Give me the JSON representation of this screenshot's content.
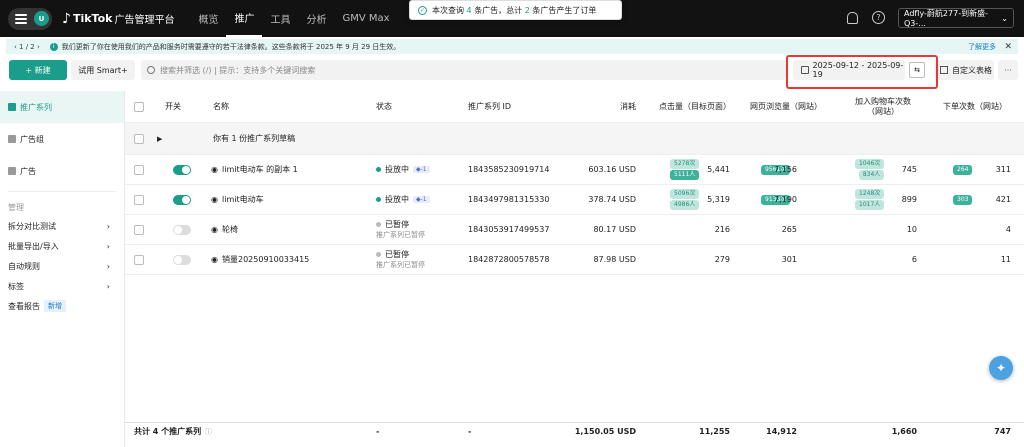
{
  "topbar": {
    "avatar_letter": "U",
    "logo_text": "TikTok",
    "logo_sub": "广告管理平台",
    "nav": [
      "概览",
      "推广",
      "工具",
      "分析",
      "GMV Max"
    ],
    "account": "Adfly-蔚航277-到新盛-Q3-..."
  },
  "toast": {
    "prefix": "本次查询",
    "ads_count": "4",
    "mid": "条广告，总计",
    "orders_count": "2",
    "suffix": "条广告产生了订单"
  },
  "notice": {
    "pager": "‹ 1 / 2 ›",
    "text": "我们更新了你在使用我们的产品和服务时需要遵守的若干法律条款。这些条款将于 2025 年 9 月 29 日生效。",
    "more": "了解更多"
  },
  "toolbar": {
    "new_label": "+ 新建",
    "smart_label": "试用 Smart+",
    "search_placeholder": "搜索并筛选 (/) | 提示：支持多个关键词搜索",
    "date_range": "2025-09-12 - 2025-09-19",
    "custom_label": "自定义表格",
    "more": "···"
  },
  "sidebar": {
    "items": [
      "推广系列",
      "广告组",
      "广告"
    ],
    "manage_heading": "管理",
    "manage": [
      "拆分对比测试",
      "批量导出/导入",
      "自动规则",
      "标签",
      "查看报告"
    ],
    "new_badge": "新增"
  },
  "table": {
    "headers": {
      "switch": "开关",
      "name": "名称",
      "status": "状态",
      "id": "推广系列 ID",
      "spend": "消耗",
      "clicks": "点击量（目标页面）",
      "views": "网页浏览量（网站）",
      "cart": "加入购物车次数",
      "cart2": "（网站）",
      "orders": "下单次数（网站）"
    },
    "draft": "你有 1 份推广系列草稿",
    "rows": [
      {
        "name": "limit电动车 的副本 1",
        "status": "投放中",
        "pill": "1",
        "sub": "",
        "id": "1843585230919714",
        "spend": "603.16 USD",
        "clicks_tag1": "5278次",
        "clicks_tag2": "5111人",
        "clicks": "5,441",
        "views_tag": "9561次",
        "views": "7,156",
        "cart_tag1": "1046次",
        "cart_tag2": "834人",
        "cart": "745",
        "orders_tag": "264",
        "orders": "311"
      },
      {
        "name": "limit电动车",
        "status": "投放中",
        "pill": "1",
        "sub": "",
        "id": "1843497981315330",
        "spend": "378.74 USD",
        "clicks_tag1": "5096次",
        "clicks_tag2": "4986人",
        "clicks": "5,319",
        "views_tag": "9133次",
        "views": "7,190",
        "cart_tag1": "1248次",
        "cart_tag2": "1017人",
        "cart": "899",
        "orders_tag": "303",
        "orders": "421"
      },
      {
        "name": "轮椅",
        "status": "已暂停",
        "pill": "",
        "sub": "推广系列已暂停",
        "id": "1843053917499537",
        "spend": "80.17 USD",
        "clicks": "216",
        "views": "265",
        "cart": "10",
        "orders": "4"
      },
      {
        "name": "销量20250910033415",
        "status": "已暂停",
        "pill": "",
        "sub": "推广系列已暂停",
        "id": "1842872800578578",
        "spend": "87.98 USD",
        "clicks": "279",
        "views": "301",
        "cart": "6",
        "orders": "11"
      }
    ],
    "footer": {
      "label": "共计 4 个推广系列",
      "status": "-",
      "id": "-",
      "spend": "1,150.05 USD",
      "clicks": "11,255",
      "views": "14,912",
      "cart": "1,660",
      "orders": "747"
    }
  },
  "colors": {
    "accent": "#1a9d8a",
    "highlight": "#e53935"
  }
}
